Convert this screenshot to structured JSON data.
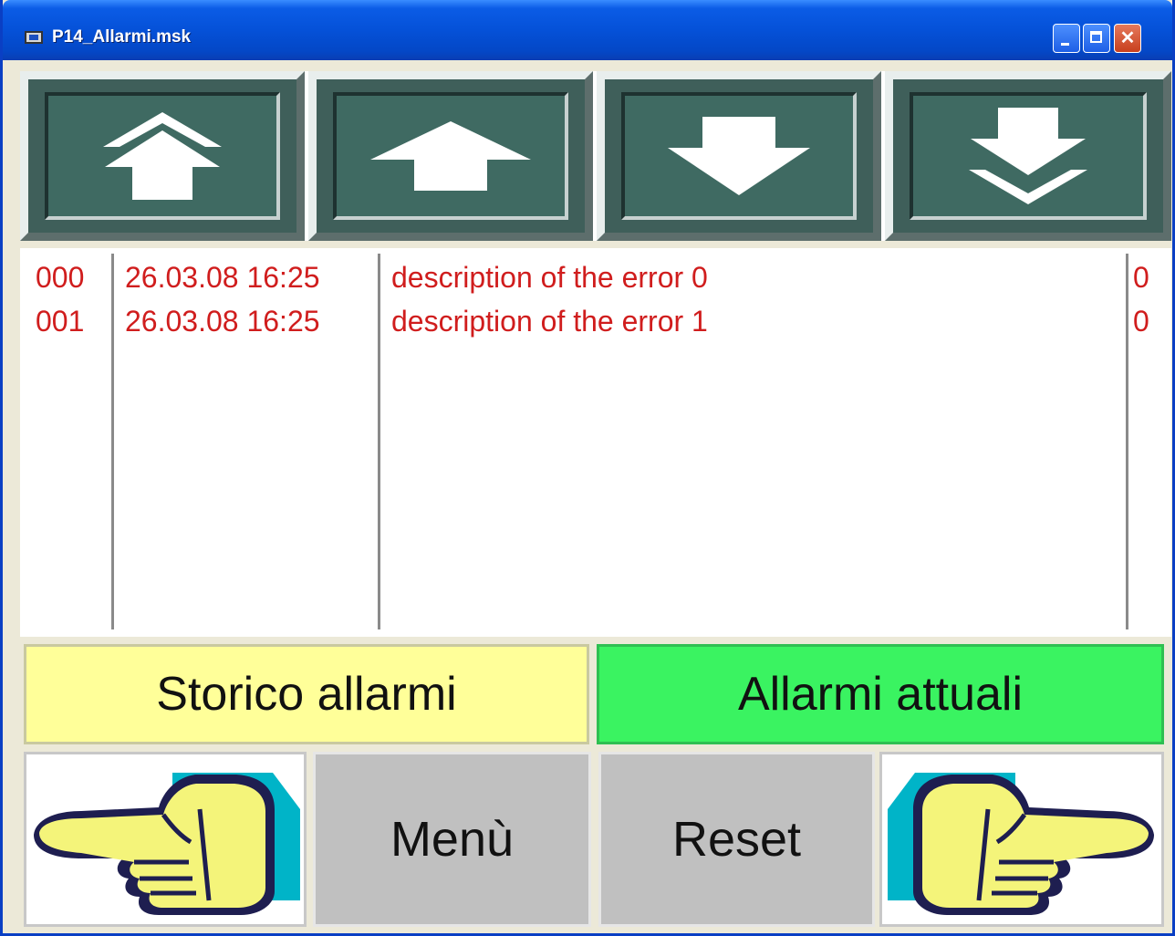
{
  "window": {
    "title": "P14_Allarmi.msk",
    "icon": "monitor-icon"
  },
  "scroll_buttons": [
    {
      "name": "page-up",
      "icon": "double-arrow-up-icon"
    },
    {
      "name": "line-up",
      "icon": "arrow-up-icon"
    },
    {
      "name": "line-down",
      "icon": "arrow-down-icon"
    },
    {
      "name": "page-down",
      "icon": "double-arrow-down-icon"
    }
  ],
  "alarms": [
    {
      "num": "000",
      "datetime": "26.03.08 16:25",
      "description": "description of the error 0",
      "flag": "0"
    },
    {
      "num": "001",
      "datetime": "26.03.08 16:25",
      "description": "description of the error 1",
      "flag": "0"
    }
  ],
  "tabs": {
    "history_label": "Storico allarmi",
    "current_label": "Allarmi attuali"
  },
  "bottom": {
    "prev_icon": "hand-pointing-left-icon",
    "menu_label": "Menù",
    "reset_label": "Reset",
    "next_icon": "hand-pointing-right-icon"
  },
  "colors": {
    "alarm_text": "#d01d1d",
    "history_tab": "#ffff99",
    "current_tab": "#3af361",
    "nav_button": "#3f6a62"
  }
}
